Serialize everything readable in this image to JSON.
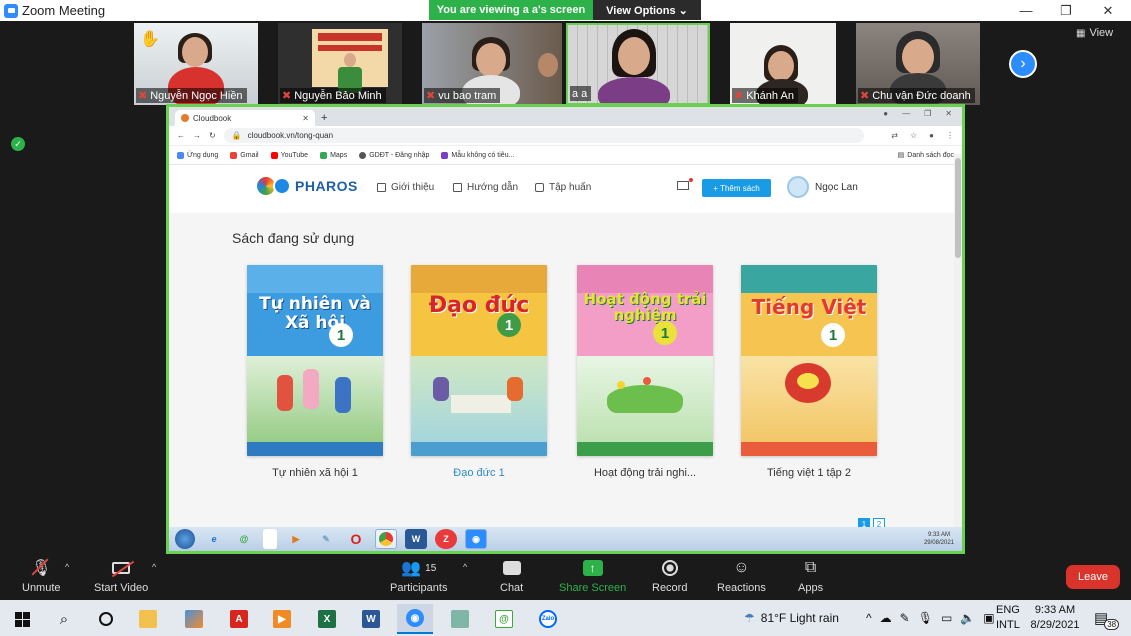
{
  "window": {
    "title": "Zoom Meeting",
    "minimize": "—",
    "maximize": "❐",
    "close": "✕"
  },
  "banner": {
    "viewing": "You are viewing a a's screen",
    "options": "View Options ⌄"
  },
  "view_button": {
    "label": "View"
  },
  "participants": [
    {
      "name": "Nguyễn Ngọc Hiền",
      "muted": true,
      "raised_hand": true
    },
    {
      "name": "Nguyễn Bảo Minh",
      "muted": true
    },
    {
      "name": "vu bao tram",
      "muted": true
    },
    {
      "name": "a a",
      "muted": false,
      "active_speaker": true
    },
    {
      "name": "Khánh An",
      "muted": true
    },
    {
      "name": "Chu vận Đức doanh",
      "muted": true
    }
  ],
  "browser": {
    "tab_title": "Cloudbook",
    "url": "cloudbook.vn/tong-quan",
    "bookmarks": [
      {
        "label": "Ứng dụng",
        "color": "#4a8af4"
      },
      {
        "label": "Gmail",
        "color": "#ea4335"
      },
      {
        "label": "YouTube",
        "color": "#ff0000"
      },
      {
        "label": "Maps",
        "color": "#34a853"
      },
      {
        "label": "GDĐT - Đăng nhập",
        "color": "#555555"
      },
      {
        "label": "Mẫu không có tiêu...",
        "color": "#7b3fc1"
      }
    ],
    "reading_list": "Danh sách đọc"
  },
  "site": {
    "brand": "PHAROS",
    "nav": [
      "Giới thiệu",
      "Hướng dẫn",
      "Tập huấn"
    ],
    "add_book": "+ Thêm sách",
    "user": "Ngọc Lan",
    "section_title": "Sách đang sử dụng",
    "books": [
      {
        "cover_title": "Tự nhiên và Xã hội",
        "number": "1",
        "label": "Tự nhiên xã hội 1",
        "bg": "#3d9ce0",
        "title_color": "#ffffff"
      },
      {
        "cover_title": "Đạo đức",
        "number": "1",
        "label": "Đạo đức 1",
        "bg": "#f5c542",
        "title_color": "#d6262b"
      },
      {
        "cover_title": "Hoạt động trải nghiệm",
        "number": "1",
        "label": "Hoạt động trải nghi...",
        "bg": "#f29ec7",
        "title_color": "#e8e23a"
      },
      {
        "cover_title": "Tiếng Việt",
        "number": "1",
        "label": "Tiếng việt 1 tập 2",
        "bg": "#f6c451",
        "title_color": "#e23a2e"
      }
    ],
    "pages": [
      "1",
      "2"
    ]
  },
  "inner_clock": {
    "time": "9:33 AM",
    "date": "29/08/2021"
  },
  "toolbar": {
    "unmute": "Unmute",
    "start_video": "Start Video",
    "participants": "Participants",
    "participants_count": "15",
    "chat": "Chat",
    "share_screen": "Share Screen",
    "record": "Record",
    "reactions": "Reactions",
    "apps": "Apps",
    "leave": "Leave"
  },
  "taskbar": {
    "weather": "81°F  Light rain",
    "language": "ENG",
    "layout": "INTL",
    "time": "9:33 AM",
    "date": "8/29/2021",
    "notifications": "38"
  }
}
